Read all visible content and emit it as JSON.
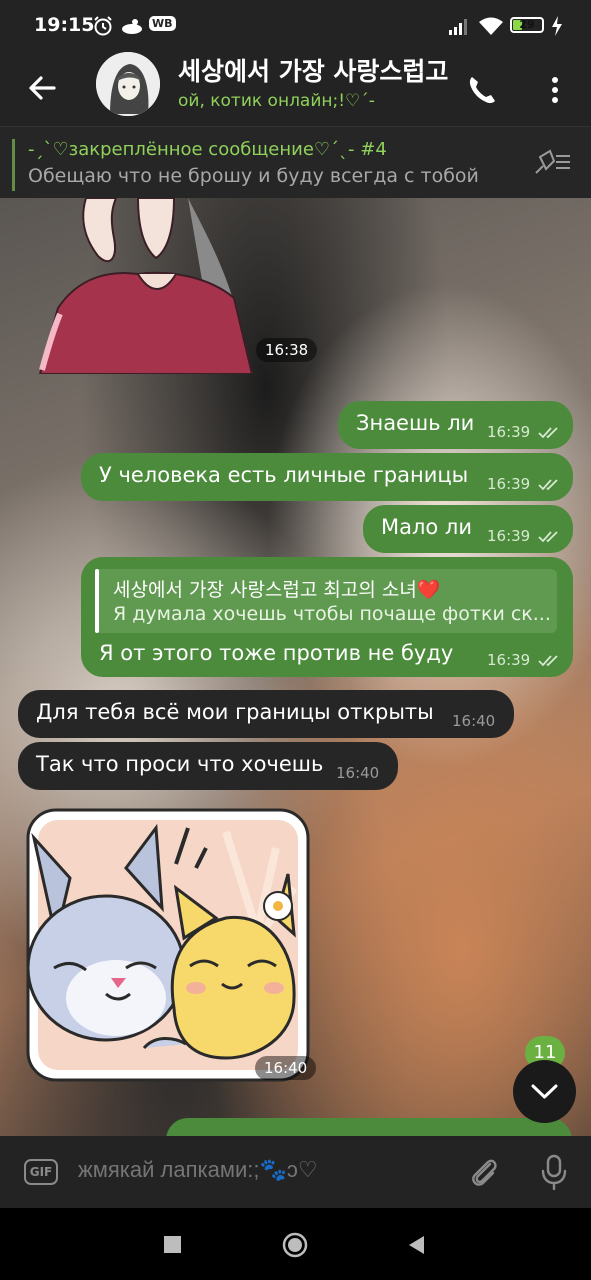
{
  "status_bar": {
    "time": "19:15",
    "wb": "WB",
    "battery": "29",
    "icons": [
      "alarm-icon",
      "cloud-icon",
      "signal-icon",
      "wifi-icon",
      "charging-icon"
    ]
  },
  "header": {
    "title": "세상에서 가장 사랑스럽고 최고의 소녀",
    "subtitle": "ой, котик онлайн;!♡´-",
    "icons": [
      "back-arrow-icon",
      "phone-icon",
      "more-vertical-icon"
    ]
  },
  "pinned": {
    "title": "-ˏˋ♡закреплённое сообщение♡ˊˎ- #4",
    "text": "Обещаю что не брошу и буду всегда с тобой"
  },
  "messages": [
    {
      "type": "sticker",
      "dir": "in",
      "time": "16:38"
    },
    {
      "type": "text",
      "dir": "out",
      "text": "Знаешь ли",
      "time": "16:39"
    },
    {
      "type": "text",
      "dir": "out",
      "text": "У человека есть личные границы",
      "time": "16:39"
    },
    {
      "type": "text",
      "dir": "out",
      "text": "Мало ли",
      "time": "16:39"
    },
    {
      "type": "reply",
      "dir": "out",
      "reply_name": "세상에서 가장 사랑스럽고 최고의 소녀❤️",
      "reply_text": "Я думала хочешь чтобы почаще фотки ск...",
      "text": "Я от этого тоже против не буду",
      "time": "16:39"
    },
    {
      "type": "text",
      "dir": "in",
      "text": "Для тебя всё мои границы открыты",
      "time": "16:40"
    },
    {
      "type": "text",
      "dir": "in",
      "text": "Так что проси что хочешь",
      "time": "16:40"
    },
    {
      "type": "sticker",
      "dir": "in",
      "time": "16:40"
    }
  ],
  "unread_badge": "11",
  "input": {
    "gif_label": "GIF",
    "placeholder": "жмякай лапками:;🐾ↄ♡"
  },
  "colors": {
    "accent": "#8fd15a",
    "outgoing_bubble": "#4b8b3b",
    "incoming_bubble": "#262626"
  }
}
